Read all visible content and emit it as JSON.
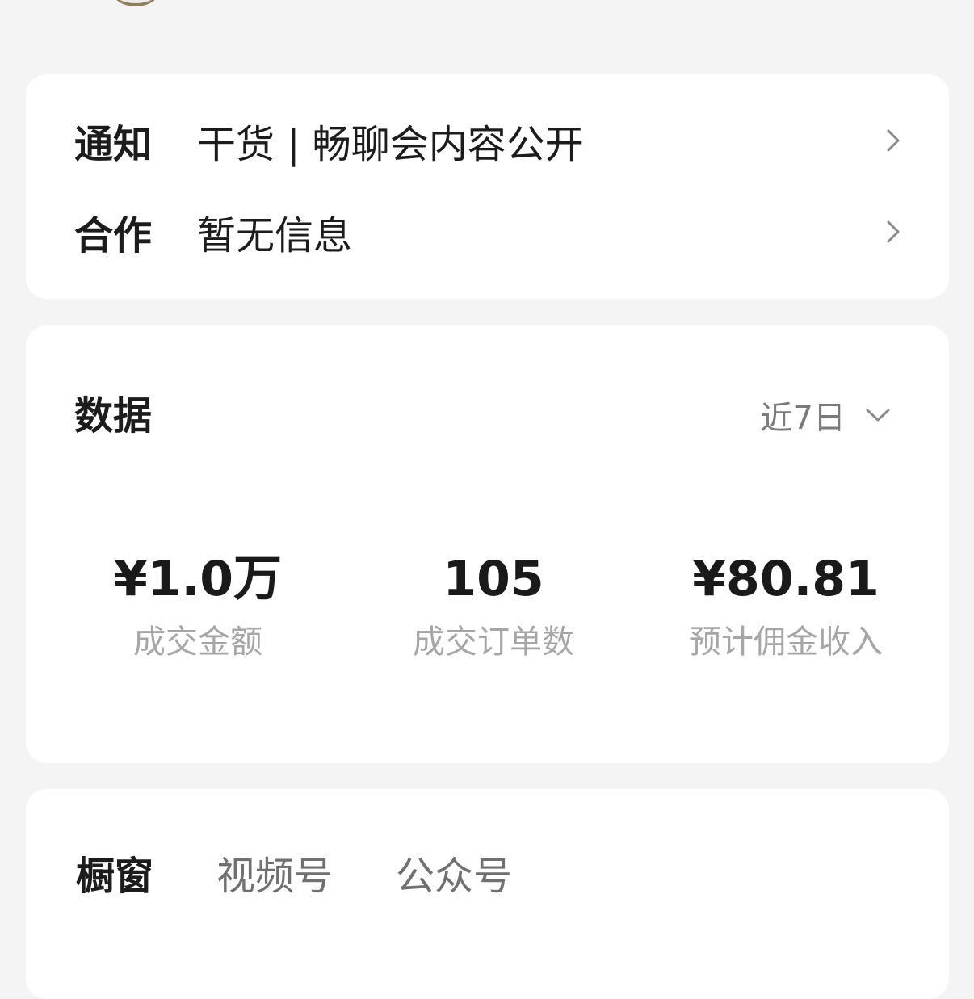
{
  "notice_card": {
    "rows": [
      {
        "label": "通知",
        "value": "干货 | 畅聊会内容公开"
      },
      {
        "label": "合作",
        "value": "暂无信息"
      }
    ]
  },
  "data_card": {
    "title": "数据",
    "range": {
      "label": "近7日"
    },
    "metrics": [
      {
        "value": "¥1.0万",
        "label": "成交金额"
      },
      {
        "value": "105",
        "label": "成交订单数"
      },
      {
        "value": "¥80.81",
        "label": "预计佣金收入"
      }
    ]
  },
  "tabs": [
    {
      "label": "橱窗"
    },
    {
      "label": "视频号"
    },
    {
      "label": "公众号"
    }
  ],
  "colors": {
    "background": "#f4f4f4",
    "card": "#ffffff",
    "primary_text": "#1c1c1c",
    "secondary_text": "#a6a6a6",
    "tab_inactive": "#707070"
  },
  "icons": {
    "row_arrow": "chevron-right-icon",
    "range_arrow": "chevron-down-icon"
  }
}
